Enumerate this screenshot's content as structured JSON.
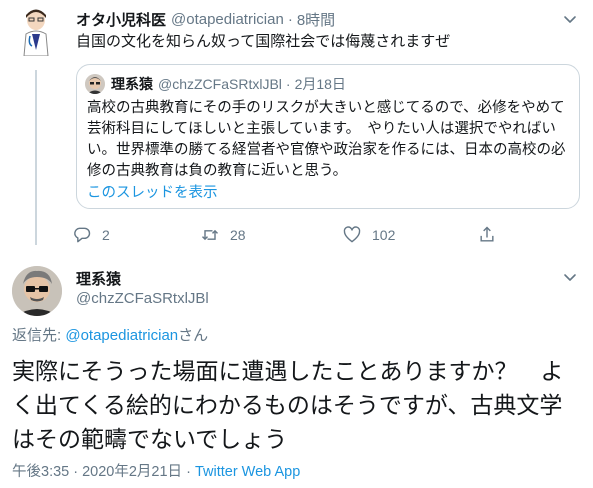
{
  "top_tweet": {
    "name": "オタ小児科医",
    "handle": "@otapediatrician",
    "separator": "·",
    "time": "8時間",
    "text": "自国の文化を知らん奴って国際社会では侮蔑されますぜ"
  },
  "quote_tweet": {
    "name": "理系猿",
    "handle": "@chzZCFaSRtxlJBl",
    "separator": "·",
    "date": "2月18日",
    "text": "高校の古典教育にその手のリスクが大きいと感じてるので、必修をやめて芸術科目にしてほしいと主張しています。　やりたい人は選択でやればいい。世界標準の勝てる経営者や官僚や政治家を作るには、日本の高校の必修の古典教育は負の教育に近いと思う。",
    "show_thread": "このスレッドを表示"
  },
  "actions": {
    "reply_count": "2",
    "retweet_count": "28",
    "like_count": "102"
  },
  "main_tweet": {
    "name": "理系猿",
    "handle": "@chzZCFaSRtxlJBl",
    "reply_prefix": "返信先: ",
    "reply_mention": "@otapediatrician",
    "reply_suffix": "さん",
    "text": "実際にそうった場面に遭遇したことありますか？　よく出てくる絵的にわかるものはそうですが、古典文学はその範疇でないでしょう",
    "timestamp": "午後3:35 · 2020年2月21日",
    "meta_separator": " · ",
    "app": "Twitter Web App"
  },
  "colors": {
    "text": "#14171a",
    "muted": "#657786",
    "link": "#1b95e0",
    "border": "#ccd6dd"
  }
}
